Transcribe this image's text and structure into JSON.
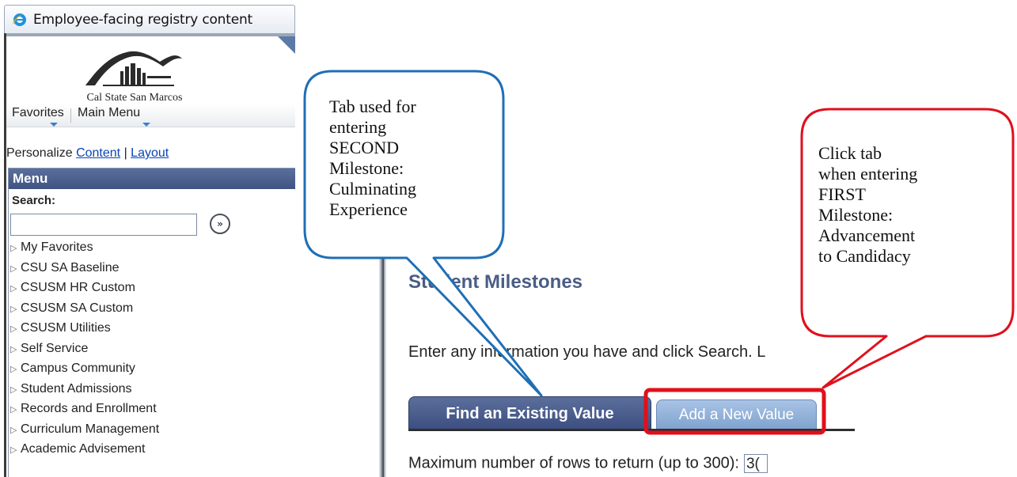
{
  "browser": {
    "tab_title": "Employee-facing registry content",
    "icon": "internet-explorer-icon"
  },
  "portal": {
    "logo_text": "Cal State San Marcos",
    "nav": {
      "favorites": "Favorites",
      "main_menu": "Main Menu"
    },
    "personalize": {
      "prefix": "Personalize",
      "content_link": "Content",
      "separator": "|",
      "layout_link": "Layout"
    },
    "menu": {
      "header": "Menu",
      "search_label": "Search:",
      "search_value": "",
      "search_go_icon": "double-chevron-right-icon",
      "items": [
        "My Favorites",
        "CSU SA Baseline",
        "CSUSM HR Custom",
        "CSUSM SA Custom",
        "CSUSM Utilities",
        "Self Service",
        "Campus Community",
        "Student Admissions",
        "Records and Enrollment",
        "Curriculum Management",
        "Academic Advisement"
      ]
    }
  },
  "app": {
    "page_title": "Student Milestones",
    "instructions": "Enter any information you have and click Search. L",
    "tabs": {
      "find": "Find an Existing Value",
      "add": "Add a New Value"
    },
    "rows_label": "Maximum number of rows to return (up to 300):",
    "rows_value": "3("
  },
  "callouts": {
    "blue": {
      "lines": [
        "Tab used for",
        "entering",
        "SECOND",
        "Milestone:",
        "Culminating",
        "Experience"
      ],
      "color": "#1f6fb5"
    },
    "red": {
      "lines": [
        "Click tab",
        "when entering",
        "FIRST",
        "Milestone:",
        "Advancement",
        "to Candidacy"
      ],
      "color": "#e0101b"
    }
  },
  "colors": {
    "menu_header": "#4a5d8e",
    "title": "#4a5d86",
    "link": "#0b44b7",
    "active_tab": "#4a5d8e",
    "inactive_tab": "#8faad4"
  }
}
